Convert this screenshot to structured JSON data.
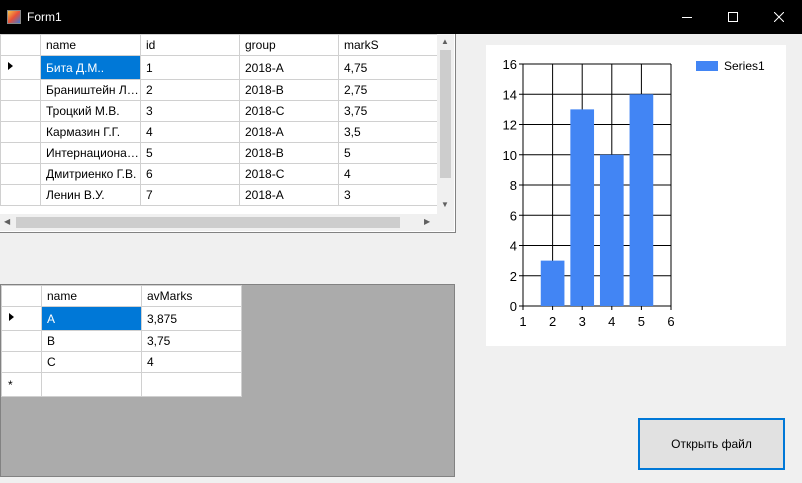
{
  "window": {
    "title": "Form1"
  },
  "grid1": {
    "columns": [
      "name",
      "id",
      "group",
      "markS"
    ],
    "rows": [
      [
        "Бита Д.М..",
        "1",
        "2018-A",
        "4,75"
      ],
      [
        "Браништейн Л.А.",
        "2",
        "2018-B",
        "2,75"
      ],
      [
        "Троцкий М.В.",
        "3",
        "2018-C",
        "3,75"
      ],
      [
        "Кармазин Г.Г.",
        "4",
        "2018-A",
        "3,5"
      ],
      [
        "Интернационал...",
        "5",
        "2018-B",
        "5"
      ],
      [
        "Дмитриенко Г.В.",
        "6",
        "2018-C",
        "4"
      ],
      [
        "Ленин В.У.",
        "7",
        "2018-A",
        "3"
      ]
    ]
  },
  "grid2": {
    "columns": [
      "name",
      "avMarks"
    ],
    "rows": [
      [
        "A",
        "3,875"
      ],
      [
        "B",
        "3,75"
      ],
      [
        "C",
        "4"
      ]
    ]
  },
  "chart_data": {
    "type": "bar",
    "x": [
      2,
      3,
      4,
      5
    ],
    "series": [
      {
        "name": "Series1",
        "values": [
          3,
          13,
          10,
          14
        ]
      }
    ],
    "xlim": [
      1,
      6
    ],
    "ylim": [
      0,
      16
    ],
    "xticks": [
      "1",
      "2",
      "3",
      "4",
      "5",
      "6"
    ],
    "yticks": [
      "0",
      "2",
      "4",
      "6",
      "8",
      "10",
      "12",
      "14",
      "16"
    ],
    "grid": true,
    "legend": "top-right",
    "color": "#4285f4"
  },
  "buttons": {
    "open_file": "Открыть файл"
  }
}
